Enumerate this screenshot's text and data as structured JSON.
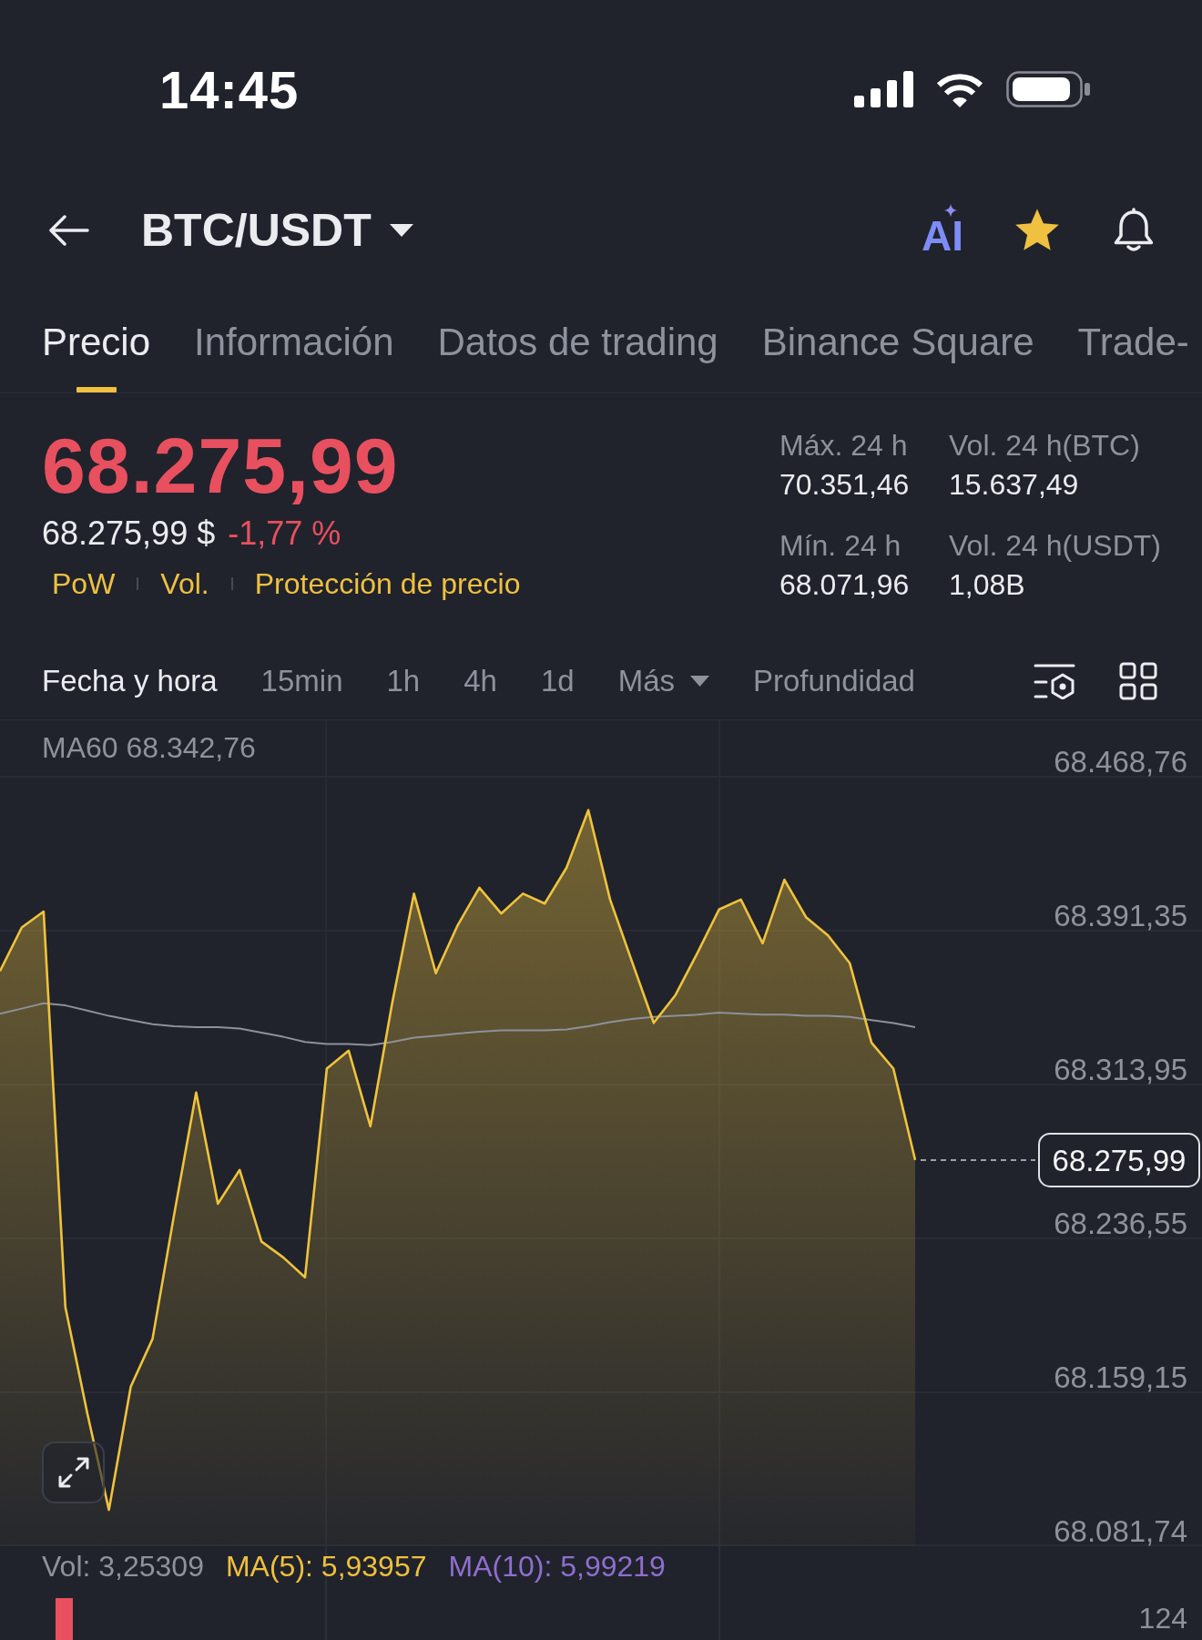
{
  "status_bar": {
    "time": "14:45"
  },
  "header": {
    "pair": "BTC/USDT",
    "ai_label": "AI",
    "favorite": true
  },
  "tabs": [
    {
      "label": "Precio",
      "selected": true
    },
    {
      "label": "Información",
      "selected": false
    },
    {
      "label": "Datos de trading",
      "selected": false
    },
    {
      "label": "Binance Square",
      "selected": false
    },
    {
      "label": "Trade-",
      "selected": false
    }
  ],
  "price": {
    "last": "68.275,99",
    "fiat": "68.275,99 $",
    "change": "-1,77 %",
    "falling": true,
    "tags": [
      "PoW",
      "Vol.",
      "Protección de precio"
    ],
    "stats": [
      {
        "label": "Máx. 24 h",
        "value": "70.351,46"
      },
      {
        "label": "Vol. 24 h(BTC)",
        "value": "15.637,49"
      },
      {
        "label": "Mín. 24 h",
        "value": "68.071,96"
      },
      {
        "label": "Vol. 24 h(USDT)",
        "value": "1,08B"
      }
    ]
  },
  "intervals": [
    {
      "label": "Fecha y hora",
      "kind": "tab",
      "selected": true
    },
    {
      "label": "15min",
      "kind": "tab",
      "selected": false
    },
    {
      "label": "1h",
      "kind": "tab",
      "selected": false
    },
    {
      "label": "4h",
      "kind": "tab",
      "selected": false
    },
    {
      "label": "1d",
      "kind": "tab",
      "selected": false
    },
    {
      "label": "Más",
      "kind": "dropdown",
      "selected": false
    },
    {
      "label": "Profundidad",
      "kind": "tab",
      "selected": false
    }
  ],
  "chart": {
    "ma_label": "MA60 68.342,76",
    "chart_data": {
      "type": "area",
      "grid": true,
      "ylim": [
        68081.74,
        68497.2
      ],
      "yticks": [
        {
          "value": 68081.74,
          "label": "68.081,74"
        },
        {
          "value": 68159.15,
          "label": "68.159,15"
        },
        {
          "value": 68236.55,
          "label": "68.236,55"
        },
        {
          "value": 68313.95,
          "label": "68.313,95"
        },
        {
          "value": 68391.35,
          "label": "68.391,35"
        },
        {
          "value": 68468.76,
          "label": "68.468,76"
        }
      ],
      "series": [
        {
          "type": "area",
          "color": "#f0c33c",
          "values": [
            68371,
            68393,
            68401,
            68202,
            68149,
            68100,
            68162,
            68186,
            68249,
            68310,
            68254,
            68271,
            68235,
            68227,
            68217,
            68322,
            68331,
            68293,
            68355,
            68410,
            68370,
            68394,
            68413,
            68400,
            68410,
            68405,
            68423,
            68452,
            68407,
            68376,
            68345,
            68359,
            68380,
            68402,
            68407,
            68385,
            68417,
            68398,
            68389,
            68375,
            68335,
            68322,
            68276
          ]
        },
        {
          "type": "line",
          "color": "#8d9199",
          "values": [
            68349.6,
            68352.2,
            68354.9,
            68353.8,
            68351.2,
            68348.5,
            68346.4,
            68344.3,
            68343.3,
            68342.8,
            68342.8,
            68342.2,
            68340.1,
            68338,
            68335.4,
            68334.3,
            68334.3,
            68333.8,
            68335.4,
            68337.5,
            68338.5,
            68339.6,
            68340.6,
            68341.2,
            68341.2,
            68341.2,
            68341.7,
            68343.3,
            68345.4,
            68347,
            68348,
            68348.5,
            68349.1,
            68350.1,
            68349.6,
            68349.1,
            68349.1,
            68348.5,
            68348.5,
            68348,
            68346.4,
            68344.9,
            68342.8
          ]
        }
      ],
      "annotations": [
        "68.275,99"
      ]
    }
  },
  "volume": {
    "legend": [
      {
        "text": "Vol: 3,25309",
        "color": "#8d929c"
      },
      {
        "text": "MA(5): 5,93957",
        "color": "#f0c03c"
      },
      {
        "text": "MA(10): 5,99219",
        "color": "#8e6fcf"
      }
    ],
    "axis_label": "124"
  }
}
